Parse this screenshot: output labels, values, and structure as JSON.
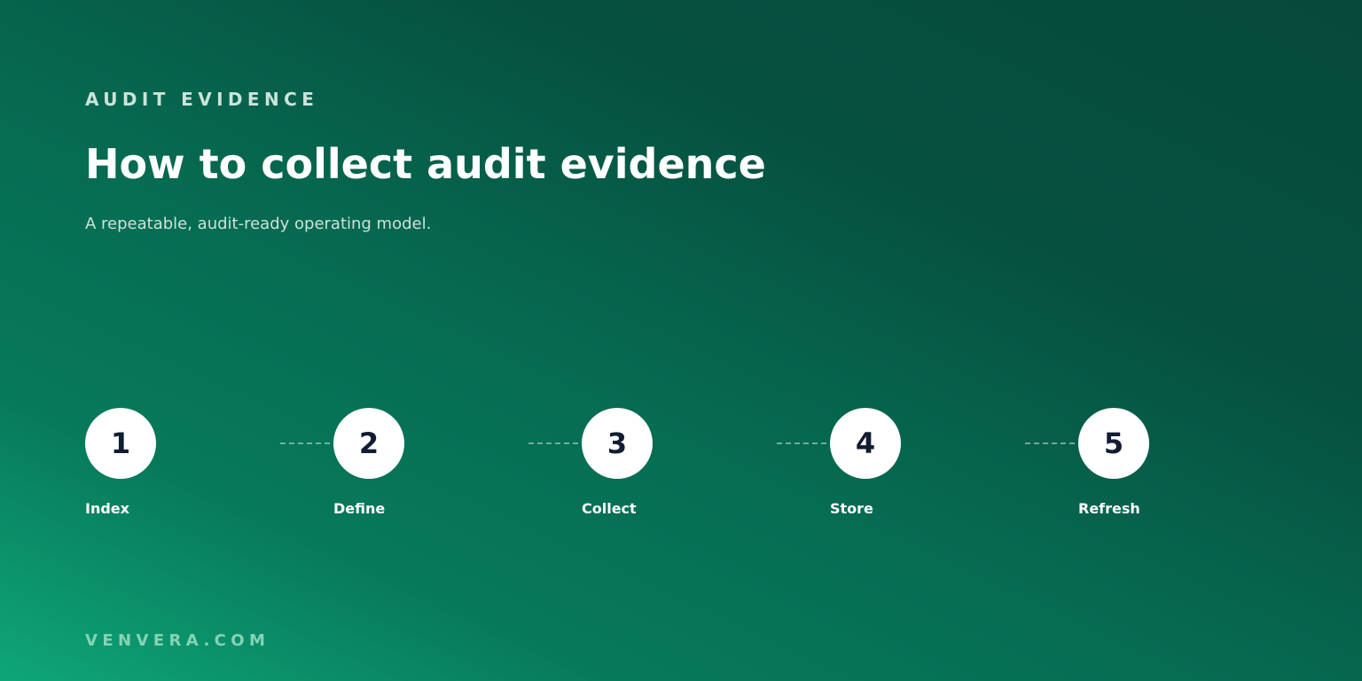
{
  "eyebrow": "AUDIT EVIDENCE",
  "title": "How to collect audit evidence",
  "subtitle": "A repeatable, audit-ready operating model.",
  "steps": [
    {
      "number": "1",
      "label": "Index"
    },
    {
      "number": "2",
      "label": "Define"
    },
    {
      "number": "3",
      "label": "Collect"
    },
    {
      "number": "4",
      "label": "Store"
    },
    {
      "number": "5",
      "label": "Refresh"
    }
  ],
  "footer": "VENVERA.COM",
  "colors": {
    "background_dark": "#064a3b",
    "background_light": "#0fa677",
    "circle_fill": "#ffffff",
    "circle_text": "#121c33",
    "muted_text": "#cde3d9",
    "footer_text": "#86d3b5"
  }
}
